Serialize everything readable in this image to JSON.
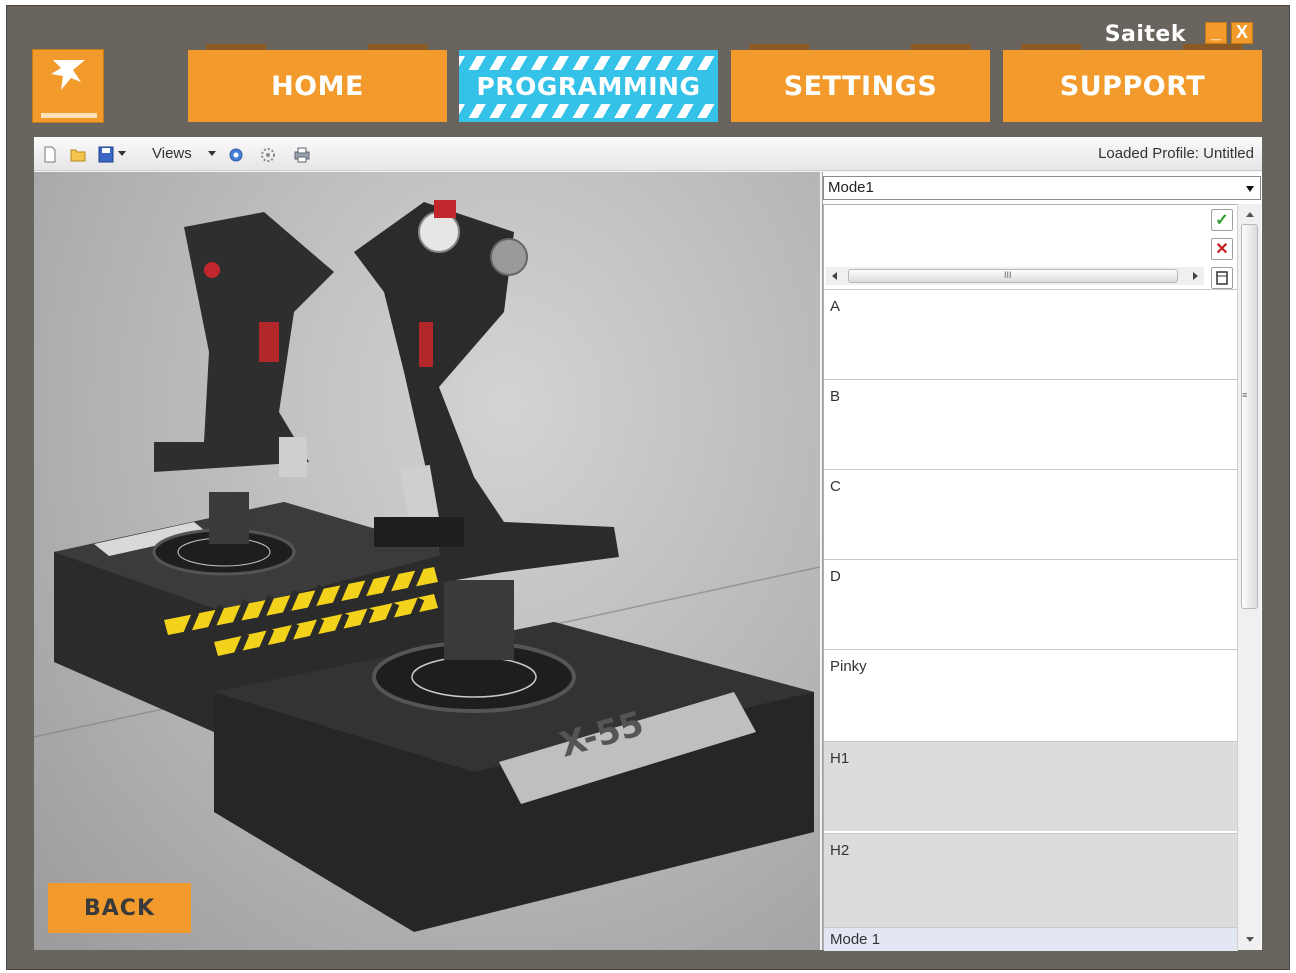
{
  "window": {
    "brand": "Saitek",
    "minimize_glyph": "_",
    "close_glyph": "X",
    "logo_icon": "jet-fighter-icon"
  },
  "nav": {
    "tabs": [
      {
        "label": "HOME",
        "active": false
      },
      {
        "label": "PROGRAMMING",
        "active": true
      },
      {
        "label": "SETTINGS",
        "active": false
      },
      {
        "label": "SUPPORT",
        "active": false
      }
    ]
  },
  "toolbar": {
    "icons": [
      "new-file-icon",
      "open-folder-icon",
      "save-icon",
      "refresh-icon",
      "settings-icon",
      "print-icon"
    ],
    "views_label": "Views",
    "loaded_profile": "Loaded Profile: Untitled"
  },
  "viewport": {
    "back_label": "BACK",
    "device_label": "X-55"
  },
  "panel": {
    "mode_select": "Mode1",
    "editor_icons": [
      "confirm-check-icon",
      "cancel-x-icon",
      "clear-icon"
    ],
    "rows": [
      {
        "label": "A",
        "shaded": false
      },
      {
        "label": "B",
        "shaded": false
      },
      {
        "label": "C",
        "shaded": false
      },
      {
        "label": "D",
        "shaded": false
      },
      {
        "label": "Pinky",
        "shaded": false
      },
      {
        "label": "H1",
        "shaded": true
      },
      {
        "label": "H2",
        "shaded": true
      }
    ],
    "footer_label": "Mode 1"
  },
  "colors": {
    "accent_orange": "#f29b2c",
    "active_tab_blue": "#34c2e8",
    "frame_gray": "#6a645e",
    "hazard_yellow": "#f2d21a"
  }
}
